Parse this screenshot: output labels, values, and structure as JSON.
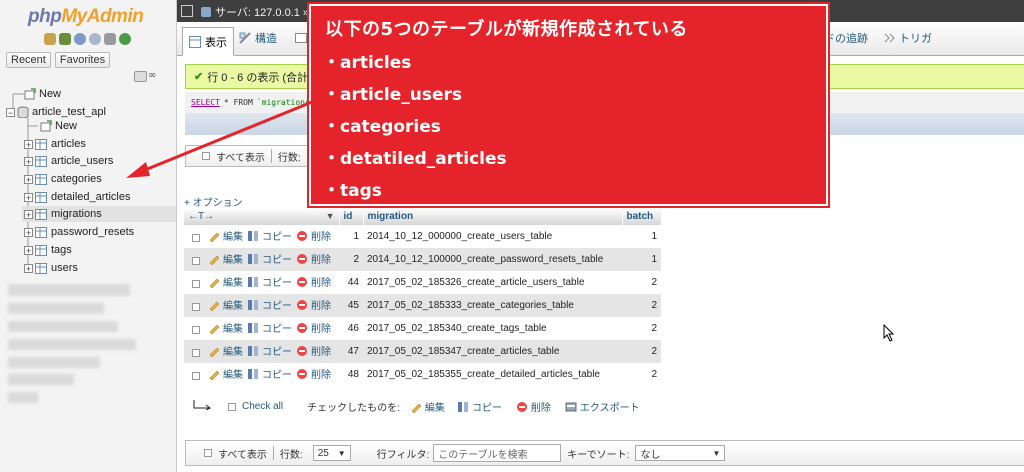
{
  "nav": {
    "logo_php": "php",
    "logo_myadmin": "MyAdmin",
    "tabs": [
      "Recent",
      "Favorites"
    ],
    "tree": [
      {
        "label": "New",
        "type": "new"
      },
      {
        "label": "article_test_apl",
        "type": "db"
      },
      {
        "label": "New",
        "type": "new"
      },
      {
        "label": "articles",
        "type": "table"
      },
      {
        "label": "article_users",
        "type": "table"
      },
      {
        "label": "categories",
        "type": "table"
      },
      {
        "label": "detailed_articles",
        "type": "table"
      },
      {
        "label": "migrations",
        "type": "table",
        "selected": true
      },
      {
        "label": "password_resets",
        "type": "table"
      },
      {
        "label": "tags",
        "type": "table"
      },
      {
        "label": "users",
        "type": "table"
      }
    ]
  },
  "topbar": {
    "breadcrumb": "サーバ: 127.0.0.1 »"
  },
  "tabs": {
    "browse": "表示",
    "structure": "構造",
    "track": "ードの追跡",
    "triggers": "トリガ"
  },
  "result": {
    "message": "行 0 - 6 の表示 (合計",
    "sql_keyword": "SELECT",
    "sql_rest": "* FROM",
    "sql_table": "`migrations`"
  },
  "pager_top": {
    "show_all": "すべて表示",
    "rows_label": "行数:"
  },
  "options_link": "+ オプション",
  "table": {
    "arrows": "←T→",
    "headers": [
      "id",
      "migration",
      "batch"
    ],
    "action_edit": "編集",
    "action_copy": "コピー",
    "action_delete": "削除",
    "rows": [
      {
        "id": "1",
        "migration": "2014_10_12_000000_create_users_table",
        "batch": "1"
      },
      {
        "id": "2",
        "migration": "2014_10_12_100000_create_password_resets_table",
        "batch": "1"
      },
      {
        "id": "44",
        "migration": "2017_05_02_185326_create_article_users_table",
        "batch": "2"
      },
      {
        "id": "45",
        "migration": "2017_05_02_185333_create_categories_table",
        "batch": "2"
      },
      {
        "id": "46",
        "migration": "2017_05_02_185340_create_tags_table",
        "batch": "2"
      },
      {
        "id": "47",
        "migration": "2017_05_02_185347_create_articles_table",
        "batch": "2"
      },
      {
        "id": "48",
        "migration": "2017_05_02_185355_create_detailed_articles_table",
        "batch": "2"
      }
    ]
  },
  "bulk": {
    "check_all": "Check all",
    "with_selected": "チェックしたものを:",
    "edit": "編集",
    "copy": "コピー",
    "delete": "削除",
    "export": "エクスポート"
  },
  "pager_bottom": {
    "show_all": "すべて表示",
    "rows_label": "行数:",
    "rows_value": "25",
    "filter_label": "行フィルタ:",
    "filter_placeholder": "このテーブルを検索",
    "sort_label": "キーでソート:",
    "sort_value": "なし"
  },
  "callout": {
    "title": "以下の5つのテーブルが新規作成されている",
    "items": [
      "・articles",
      "・article_users",
      "・categories",
      "・detatiled_articles",
      "・tags"
    ]
  },
  "colors": {
    "callout_red": "#e5232a",
    "link_blue": "#235a81",
    "success_bg": "#ebf8a4"
  }
}
